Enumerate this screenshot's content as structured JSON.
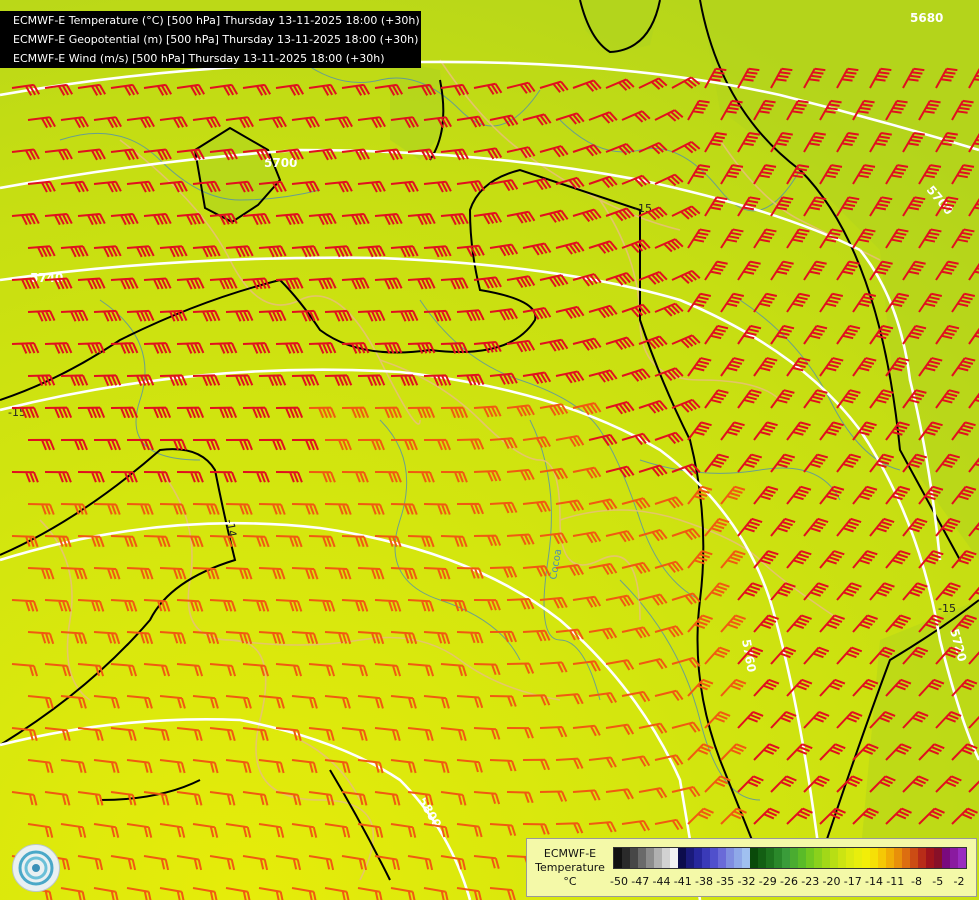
{
  "titles": [
    "ECMWF-E Temperature (°C) [500 hPa] Thursday 13-11-2025 18:00 (+30h)",
    "ECMWF-E Geopotential (m) [500 hPa] Thursday 13-11-2025 18:00 (+30h)",
    "ECMWF-E Wind (m/s) [500 hPa] Thursday 13-11-2025 18:00 (+30h)"
  ],
  "legend": {
    "model": "ECMWF-E",
    "variable": "Temperature",
    "unit": "°C",
    "ticks": [
      "-50",
      "-47",
      "-44",
      "-41",
      "-38",
      "-35",
      "-32",
      "-29",
      "-26",
      "-23",
      "-20",
      "-17",
      "-14",
      "-11",
      "-8",
      "-5",
      "-2"
    ],
    "colors": [
      "#111111",
      "#2a2a2a",
      "#474747",
      "#6a6a6a",
      "#8c8c8c",
      "#b0b0b0",
      "#d2d2d2",
      "#f2f2f2",
      "#0c0c4c",
      "#1a1a7a",
      "#27279c",
      "#3a3ab8",
      "#5050cc",
      "#6a6ad8",
      "#7f8de0",
      "#8fa8e8",
      "#a0c0f0",
      "#0a4a0a",
      "#135f13",
      "#1d731d",
      "#2a882a",
      "#3a9c3a",
      "#4aac30",
      "#5abb28",
      "#72c820",
      "#8ad11c",
      "#a2d818",
      "#b8de14",
      "#cce412",
      "#dcea10",
      "#e8ee0c",
      "#f2ee08",
      "#f6e006",
      "#f5c805",
      "#f0ad06",
      "#e8900a",
      "#dc6e10",
      "#cc4c14",
      "#b82c18",
      "#a0141c",
      "#881028",
      "#7a0a7e",
      "#8a1aa0",
      "#9a2cc0",
      "#7a1aa8",
      "#5e1290",
      "#4a0e78"
    ]
  },
  "contour_labels": {
    "geopotential": [
      "5680",
      "5700",
      "5720",
      "5740",
      "5760",
      "5780",
      "5800"
    ],
    "temperature": [
      "-15",
      "-14",
      "-15",
      "-15"
    ]
  },
  "map_labels": [
    "Cocoa"
  ],
  "colors": {
    "field_cold": "#b3d81e",
    "field_mid": "#cce212",
    "field_warm": "#e2ea0c",
    "geopotential_line": "#ffffff",
    "temp_line": "#000000",
    "barb_red": "#e0101e",
    "barb_orange": "#f05a10",
    "border": "#e8c07a",
    "river": "#4a8ab8"
  }
}
